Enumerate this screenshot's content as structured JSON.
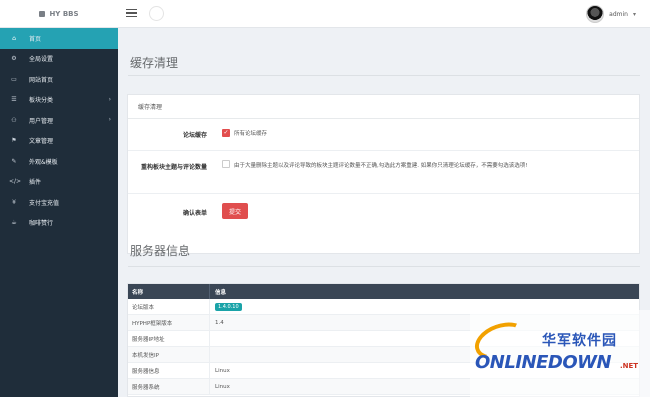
{
  "brand": {
    "name": "HY BBS"
  },
  "user": {
    "name": "admin",
    "caret": "▾"
  },
  "nav": {
    "items": [
      {
        "label": "首页",
        "icon": "⌂",
        "active": true
      },
      {
        "label": "全局设置",
        "icon": "⚙"
      },
      {
        "label": "网站首页",
        "icon": "▭"
      },
      {
        "label": "板块分类",
        "icon": "☰",
        "arrow": "›"
      },
      {
        "label": "用户管理",
        "icon": "⚇",
        "arrow": "›"
      },
      {
        "label": "文章管理",
        "icon": "⚑"
      },
      {
        "label": "外观&模板",
        "icon": "✎"
      },
      {
        "label": "插件",
        "icon": "</>"
      },
      {
        "label": "支付宝充值",
        "icon": "¥"
      },
      {
        "label": "咖啡赞行",
        "icon": "☕"
      }
    ]
  },
  "cache": {
    "title": "缓存清理",
    "panel_heading": "缓存清理",
    "row1_label": "论坛缓存",
    "row1_option": "所有论坛缓存",
    "row2_label": "重构板块主题与评论数量",
    "row2_text": "由于大量删除主题以及评论导致的板块主题评论数量不正确,勾选此方案重建. 如果你只清理论坛缓存，不需要勾选该选项!",
    "row3_label": "确认表单",
    "submit_label": "提交"
  },
  "server": {
    "title": "服务器信息",
    "headers": [
      "名称",
      "信息"
    ],
    "rows": [
      {
        "name": "论坛版本",
        "value": "1.4.0.10",
        "badge": true
      },
      {
        "name": "HYPHP框架版本",
        "value": "1.4"
      },
      {
        "name": "服务器IP地址",
        "value": ""
      },
      {
        "name": "本机发信IP",
        "value": ""
      },
      {
        "name": "服务器信息",
        "value": "Linux"
      },
      {
        "name": "服务器系统",
        "value": "Linux"
      }
    ]
  },
  "watermark": {
    "cn": "华军软件园",
    "en": "ONLINEDOWN",
    "net": ".NET"
  }
}
